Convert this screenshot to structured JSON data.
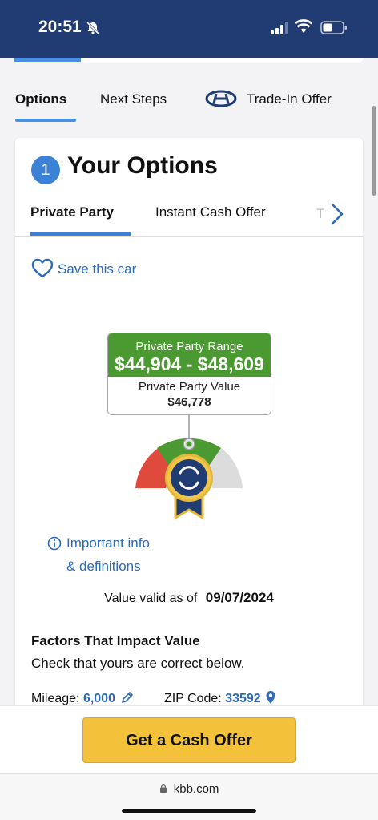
{
  "status_bar": {
    "time": "20:51"
  },
  "top_tabs": {
    "options": "Options",
    "next_steps": "Next Steps",
    "trade_in": "Trade-In Offer"
  },
  "card": {
    "step_number": "1",
    "title": "Your Options",
    "sub_tabs": {
      "private_party": "Private Party",
      "instant_cash": "Instant Cash Offer",
      "faded": "T"
    },
    "save_label": "Save this car",
    "value_box": {
      "range_label": "Private Party Range",
      "range_values": "$44,904 - $48,609",
      "ppv_label": "Private Party Value",
      "ppv_value": "$46,778"
    },
    "info_line1": "Important info",
    "info_line2": "& definitions",
    "valid_prefix": "Value valid as of",
    "valid_date": "09/07/2024",
    "factors_title": "Factors That Impact Value",
    "factors_sub": "Check that yours are correct below.",
    "mileage_label": "Mileage:",
    "mileage_value": "6,000",
    "zip_label": "ZIP Code:",
    "zip_value": "33592"
  },
  "cta": {
    "label": "Get a Cash Offer"
  },
  "browser": {
    "url": "kbb.com"
  },
  "colors": {
    "header": "#213b73",
    "accent_blue": "#3b82d6",
    "range_green": "#4a9a31",
    "cta_yellow": "#f3c13a"
  }
}
